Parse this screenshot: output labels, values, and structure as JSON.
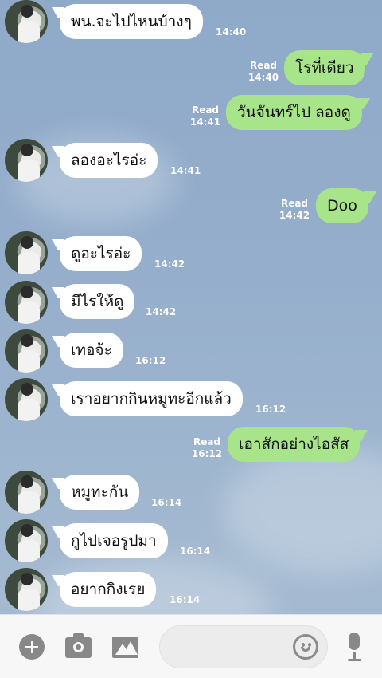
{
  "chat": {
    "messages": [
      {
        "dir": "in",
        "text": "พน.จะไปไหนบ้างๆ",
        "time": "14:40"
      },
      {
        "dir": "out",
        "text": "โรที่เดียว",
        "time": "14:40",
        "read": "Read"
      },
      {
        "dir": "out",
        "text": "วันจันทร์ไป ลองดู",
        "time": "14:41",
        "read": "Read"
      },
      {
        "dir": "in",
        "text": "ลองอะไรอ่ะ",
        "time": "14:41"
      },
      {
        "dir": "out",
        "text": "Doo",
        "time": "14:42",
        "read": "Read"
      },
      {
        "dir": "in",
        "text": "ดูอะไรอ่ะ",
        "time": "14:42"
      },
      {
        "dir": "in",
        "text": "มีไรให้ดู",
        "time": "14:42"
      },
      {
        "dir": "in",
        "text": "เทอจ้ะ",
        "time": "16:12"
      },
      {
        "dir": "in",
        "text": "เราอยากกินหมูทะอีกแล้ว",
        "time": "16:12"
      },
      {
        "dir": "out",
        "text": "เอาสักอย่างไอสัส",
        "time": "16:12",
        "read": "Read"
      },
      {
        "dir": "in",
        "text": "หมูทะกัน",
        "time": "16:14"
      },
      {
        "dir": "in",
        "text": "กูไปเจอรูปมา",
        "time": "16:14"
      },
      {
        "dir": "in",
        "text": "อยากกิงเรย",
        "time": "16:14"
      }
    ]
  },
  "toolbar": {
    "plus_icon": "plus-circle-icon",
    "camera_icon": "camera-icon",
    "image_icon": "image-icon",
    "emoji_icon": "smiley-icon",
    "mic_icon": "microphone-icon",
    "input_value": ""
  },
  "colors": {
    "incoming_bubble": "#ffffff",
    "outgoing_bubble": "#a8e58a",
    "background": "#93acc9"
  }
}
